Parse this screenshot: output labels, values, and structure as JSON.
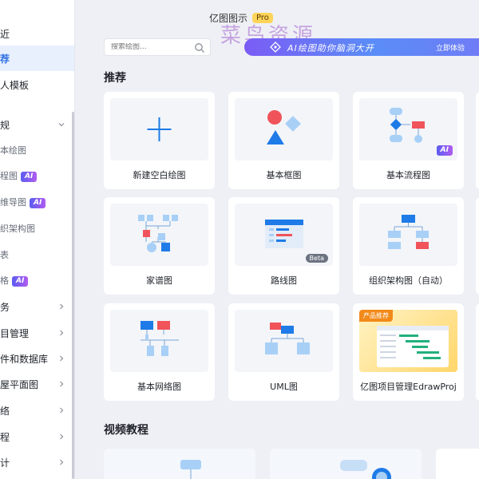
{
  "header": {
    "title": "亿图图示",
    "pro_label": "Pro",
    "watermark": "菜鸟资源"
  },
  "search": {
    "placeholder": "搜索绘图..."
  },
  "banner": {
    "text": "AI绘图助你脑洞大开",
    "button": "立即体验"
  },
  "sidebar": {
    "items": [
      {
        "label": "近",
        "type": "top",
        "active": false
      },
      {
        "label": "荐",
        "type": "top",
        "active": true
      },
      {
        "label": "人模板",
        "type": "top",
        "active": false
      },
      {
        "label": "规",
        "type": "group",
        "expanded": true
      },
      {
        "label": "本绘图",
        "type": "sub"
      },
      {
        "label": "程图",
        "type": "sub",
        "ai": "AI"
      },
      {
        "label": "维导图",
        "type": "sub",
        "ai": "AI"
      },
      {
        "label": "织架构图",
        "type": "sub"
      },
      {
        "label": "表",
        "type": "sub"
      },
      {
        "label": "格",
        "type": "sub",
        "ai": "AI"
      },
      {
        "label": "务",
        "type": "group"
      },
      {
        "label": "目管理",
        "type": "group"
      },
      {
        "label": "件和数据库",
        "type": "group"
      },
      {
        "label": "屋平面图",
        "type": "group"
      },
      {
        "label": "络",
        "type": "group"
      },
      {
        "label": "程",
        "type": "group"
      },
      {
        "label": "计",
        "type": "group"
      }
    ]
  },
  "recommend": {
    "title": "推荐",
    "cards": [
      {
        "name": "新建空白绘图"
      },
      {
        "name": "基本框图"
      },
      {
        "name": "基本流程图",
        "badge": "AI"
      },
      {
        "name": "家谱图"
      },
      {
        "name": "路线图",
        "badge": "Beta"
      },
      {
        "name": "组织架构图（自动）"
      },
      {
        "name": "基本网络图"
      },
      {
        "name": "UML图"
      },
      {
        "name": "亿图项目管理EdrawProj",
        "tag": "产品推荐"
      }
    ]
  },
  "videos": {
    "title": "视频教程"
  },
  "colors": {
    "accent": "#2f6ee5",
    "red": "#f0535a",
    "blue": "#1e7be7",
    "light_blue": "#a8d0f7"
  }
}
